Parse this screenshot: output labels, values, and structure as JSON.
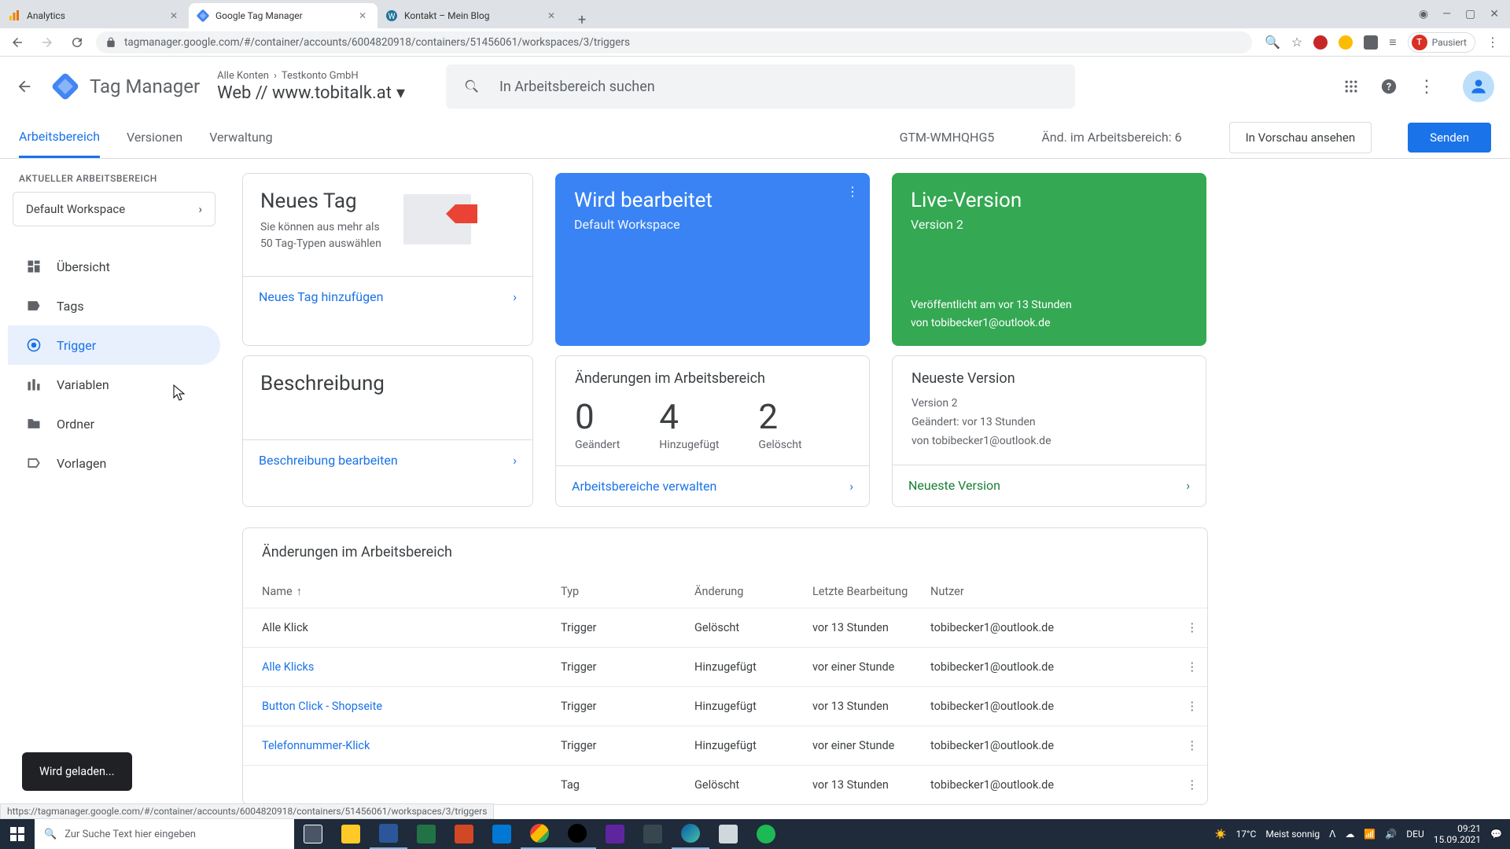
{
  "browser": {
    "tabs": [
      {
        "title": "Analytics",
        "favicon": "analytics"
      },
      {
        "title": "Google Tag Manager",
        "favicon": "gtm",
        "active": true
      },
      {
        "title": "Kontakt – Mein Blog",
        "favicon": "wp"
      }
    ],
    "url": "tagmanager.google.com/#/container/accounts/6004820918/containers/51456061/workspaces/3/triggers",
    "profile_label": "Pausiert",
    "profile_initial": "T"
  },
  "header": {
    "product": "Tag Manager",
    "breadcrumb_all": "Alle Konten",
    "breadcrumb_acct": "Testkonto GmbH",
    "container": "Web // www.tobitalk.at",
    "search_placeholder": "In Arbeitsbereich suchen"
  },
  "toptabs": {
    "workspace": "Arbeitsbereich",
    "versions": "Versionen",
    "admin": "Verwaltung",
    "container_id": "GTM-WMHQHG5",
    "changes_label": "Änd. im Arbeitsbereich: 6",
    "preview": "In Vorschau ansehen",
    "submit": "Senden"
  },
  "sidebar": {
    "ws_label": "AKTUELLER ARBEITSBEREICH",
    "ws_name": "Default Workspace",
    "items": [
      {
        "label": "Übersicht"
      },
      {
        "label": "Tags"
      },
      {
        "label": "Trigger"
      },
      {
        "label": "Variablen"
      },
      {
        "label": "Ordner"
      },
      {
        "label": "Vorlagen"
      }
    ]
  },
  "cards": {
    "newtag": {
      "title": "Neues Tag",
      "desc": "Sie können aus mehr als 50 Tag-Typen auswählen",
      "action": "Neues Tag hinzufügen"
    },
    "editing": {
      "title": "Wird bearbeitet",
      "sub": "Default Workspace"
    },
    "live": {
      "title": "Live-Version",
      "sub": "Version 2",
      "pub1": "Veröffentlicht am vor 13 Stunden",
      "pub2": "von tobibecker1@outlook.de"
    },
    "desc": {
      "title": "Beschreibung",
      "action": "Beschreibung bearbeiten"
    },
    "stats": {
      "title": "Änderungen im Arbeitsbereich",
      "changed_n": "0",
      "changed_l": "Geändert",
      "added_n": "4",
      "added_l": "Hinzugefügt",
      "deleted_n": "2",
      "deleted_l": "Gelöscht",
      "action": "Arbeitsbereiche verwalten"
    },
    "latest": {
      "title": "Neueste Version",
      "v": "Version 2",
      "l1": "Geändert: vor 13 Stunden",
      "l2": "von tobibecker1@outlook.de",
      "action": "Neueste Version"
    }
  },
  "changes": {
    "title": "Änderungen im Arbeitsbereich",
    "cols": {
      "name": "Name",
      "type": "Typ",
      "change": "Änderung",
      "last": "Letzte Bearbeitung",
      "user": "Nutzer"
    },
    "rows": [
      {
        "name": "Alle Klick",
        "link": false,
        "type": "Trigger",
        "change": "Gelöscht",
        "last": "vor 13 Stunden",
        "user": "tobibecker1@outlook.de"
      },
      {
        "name": "Alle Klicks",
        "link": true,
        "type": "Trigger",
        "change": "Hinzugefügt",
        "last": "vor einer Stunde",
        "user": "tobibecker1@outlook.de"
      },
      {
        "name": "Button Click - Shopseite",
        "link": true,
        "type": "Trigger",
        "change": "Hinzugefügt",
        "last": "vor 13 Stunden",
        "user": "tobibecker1@outlook.de"
      },
      {
        "name": "Telefonnummer-Klick",
        "link": true,
        "type": "Trigger",
        "change": "Hinzugefügt",
        "last": "vor einer Stunde",
        "user": "tobibecker1@outlook.de"
      },
      {
        "name": "",
        "link": false,
        "type": "Tag",
        "change": "Gelöscht",
        "last": "vor 13 Stunden",
        "user": "tobibecker1@outlook.de"
      }
    ]
  },
  "toast": "Wird geladen...",
  "status_url": "https://tagmanager.google.com/#/container/accounts/6004820918/containers/51456061/workspaces/3/triggers",
  "taskbar": {
    "search": "Zur Suche Text hier eingeben",
    "weather_temp": "17°C",
    "weather_text": "Meist sonnig",
    "lang": "DEU",
    "time": "09:21",
    "date": "15.09.2021"
  },
  "colors": {
    "primary": "#1a73e8",
    "blue_card": "#3983f4",
    "green_card": "#34a853"
  }
}
